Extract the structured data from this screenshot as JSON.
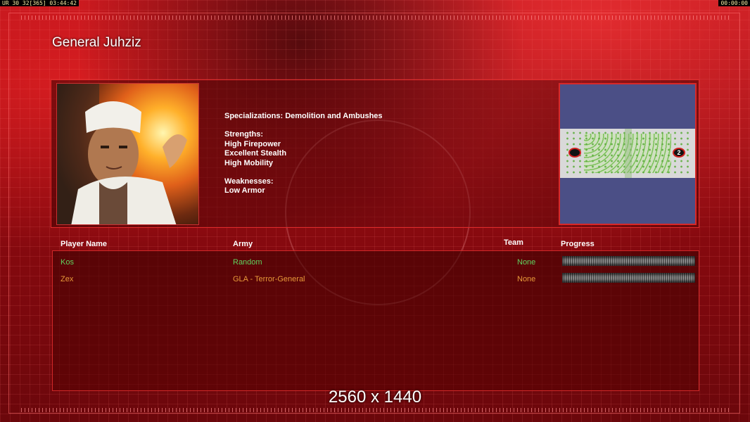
{
  "hud": {
    "left": "UR 30 32[365] 03:44:42",
    "right": "00:00:00"
  },
  "general": {
    "name": "General Juhziz",
    "specializations": "Specializations: Demolition and Ambushes",
    "strengths_heading": "Strengths:",
    "strengths": [
      "High Firepower",
      "Excellent Stealth",
      "High Mobility"
    ],
    "weaknesses_heading": "Weaknesses:",
    "weaknesses": [
      "Low Armor"
    ]
  },
  "minimap": {
    "spawn_1": "",
    "spawn_2": "2"
  },
  "players_table": {
    "headers": {
      "player_name": "Player Name",
      "army": "Army",
      "team": "Team",
      "progress": "Progress"
    },
    "rows": [
      {
        "name": "Kos",
        "army": "Random",
        "team": "None",
        "progress": 0,
        "color": "#5fd35f"
      },
      {
        "name": "Zex",
        "army": "GLA - Terror-General",
        "team": "None",
        "progress": 0,
        "color": "#e89a3a"
      }
    ]
  },
  "overlay": {
    "resolution": "2560 x 1440"
  },
  "colors": {
    "accent": "#d82828",
    "background": "#8e0a10"
  }
}
